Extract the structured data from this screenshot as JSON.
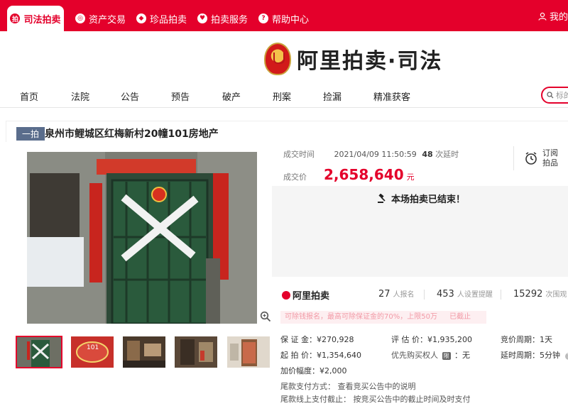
{
  "topbar": {
    "tabs": [
      {
        "label": "司法拍卖",
        "icon": "gavel-icon",
        "glyph": "拍"
      },
      {
        "label": "资产交易",
        "icon": "asset-icon",
        "glyph": "◎"
      },
      {
        "label": "珍品拍卖",
        "icon": "gem-icon",
        "glyph": "◆"
      },
      {
        "label": "拍卖服务",
        "icon": "heart-icon",
        "glyph": "♥"
      },
      {
        "label": "帮助中心",
        "icon": "help-icon",
        "glyph": "?"
      }
    ],
    "user_label": "我的"
  },
  "logo": {
    "title": "阿里拍卖·司法"
  },
  "nav": {
    "items": [
      "首页",
      "法院",
      "公告",
      "预告",
      "破产",
      "刑案",
      "捡漏",
      "精准获客"
    ],
    "search_placeholder": "标的"
  },
  "item": {
    "badge": "一拍",
    "title": "泉州市鲤城区红梅新村20幢101房地产"
  },
  "deal": {
    "time_label": "成交时间",
    "time_value": "2021/04/09 11:50:59",
    "delay_count": "48",
    "delay_label": "次延时",
    "price_label": "成交价",
    "price_value": "2,658,640",
    "price_unit": "元",
    "remind_label": "订阅拍品",
    "ended_message": "本场拍卖已结束！"
  },
  "stats": {
    "brand": "阿里拍卖",
    "signups": "27",
    "signups_label": "人报名",
    "reminders": "453",
    "reminders_label": "人设置提醒",
    "views": "15292",
    "views_label": "次围观"
  },
  "notice": {
    "text": "可除钱报名，最高可除保证金的70%，上限50万",
    "end": "已截止"
  },
  "details": {
    "deposit": "保 证 金：¥270,928",
    "start_price": "起 拍 价：¥1,354,640",
    "increment": "加价幅度：¥2,000",
    "valuation": "评 估 价：¥1,935,200",
    "priority_label": "优先购买权人",
    "priority_value": "：无",
    "priority_tag": "限",
    "cycle": "竞价周期：1天",
    "delay_cycle": "延时周期：5分钟",
    "payment_method": "尾款支付方式：   查看竞买公告中的说明",
    "payment_deadline": "尾款线上支付截止：  按竞买公告中的截止时间及时支付"
  },
  "colors": {
    "brand": "#e4002b",
    "badge": "#5a6d8c"
  }
}
